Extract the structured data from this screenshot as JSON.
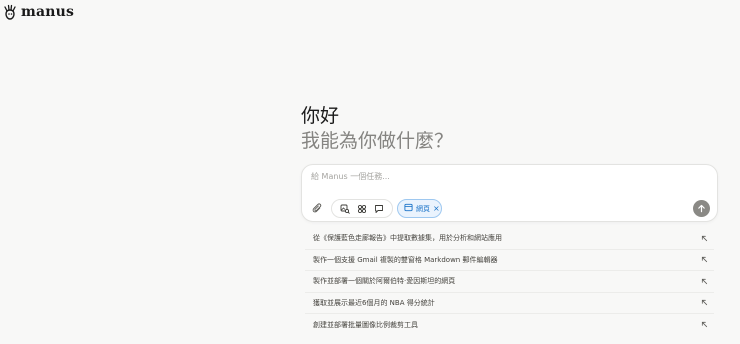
{
  "brand": {
    "name": "manus"
  },
  "hero": {
    "greeting": "你好",
    "question": "我能為你做什麼？"
  },
  "composer": {
    "placeholder": "給 Manus 一個任務..."
  },
  "chip": {
    "label": "網頁",
    "icon": "browser-icon"
  },
  "tools": [
    "paperclip-icon",
    "image-search-icon",
    "apps-icon",
    "chat-icon"
  ],
  "suggestions": [
    "從《保護藍色走廊報告》中提取數據集，用於分析和網站應用",
    "製作一個支援 Gmail 複製的雙窗格 Markdown 郵件編輯器",
    "製作並部署一個關於阿爾伯特·愛因斯坦的網頁",
    "獲取並展示最近6個月的 NBA 得分統計",
    "創建並部署批量圖像比例裁剪工具"
  ],
  "colors": {
    "background": "#f8f8f7",
    "accent": "#1a73c8",
    "send": "#8a8985"
  }
}
